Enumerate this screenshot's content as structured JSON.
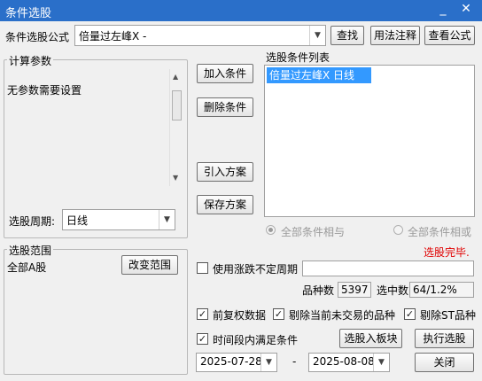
{
  "window": {
    "title": "条件选股",
    "minimize_glyph": "_",
    "close_glyph": "✕"
  },
  "formula": {
    "label": "条件选股公式",
    "selected": "倍量过左峰X  -",
    "find_button": "查找",
    "usage_button": "用法注释",
    "view_button": "查看公式"
  },
  "params": {
    "group_label": "计算参数",
    "message": "无参数需要设置",
    "period_label": "选股周期:",
    "period_value": "日线"
  },
  "actions": {
    "add": "加入条件",
    "delete": "删除条件",
    "import": "引入方案",
    "save": "保存方案"
  },
  "conditions": {
    "label": "选股条件列表",
    "items": [
      "倍量过左峰X  日线"
    ],
    "radio_and": "全部条件相与",
    "radio_or": "全部条件相或",
    "status": "选股完毕."
  },
  "range": {
    "group_label": "选股范围",
    "value": "全部A股",
    "change_button": "改变范围"
  },
  "options": {
    "variable_period_label": "使用涨跌不定周期",
    "variable_period_checked": false,
    "stock_count_label": "品种数",
    "stock_count": "5397",
    "selected_label": "选中数",
    "selected_value": "64/1.2%",
    "fq_label": "前复权数据",
    "fq_checked": true,
    "exclude_untraded_label": "剔除当前未交易的品种",
    "exclude_untraded_checked": true,
    "exclude_st_label": "剔除ST品种",
    "exclude_st_checked": true,
    "period_condition_label": "时间段内满足条件",
    "period_condition_checked": true,
    "to_block_button": "选股入板块",
    "execute_button": "执行选股",
    "date_from": "2025-07-28",
    "date_separator": "-",
    "date_to": "2025-08-08",
    "close_button": "关闭"
  },
  "colors": {
    "title_bar": "#2a6fc9",
    "selection": "#3399ff",
    "status": "#e00000"
  }
}
